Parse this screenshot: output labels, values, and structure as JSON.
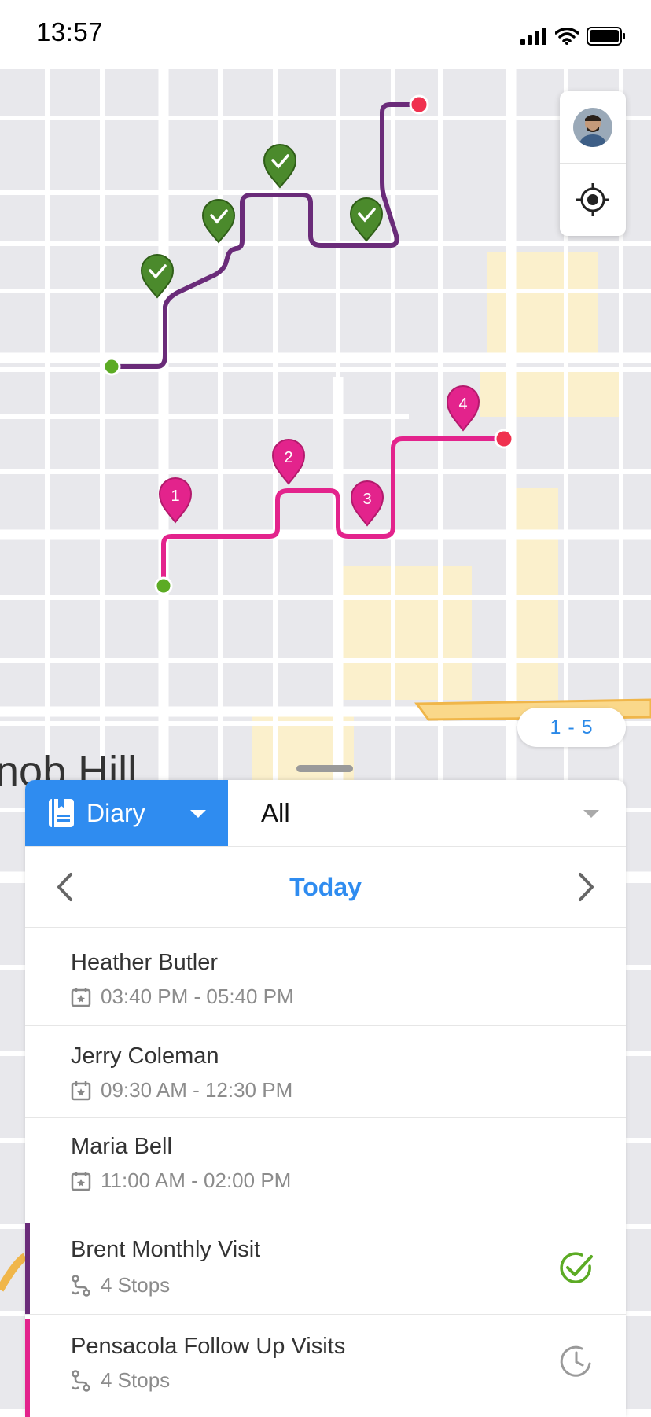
{
  "status_bar": {
    "time": "13:57"
  },
  "map": {
    "neighborhood_label": "nob Hill",
    "page_indicator": "1 - 5",
    "routes": [
      {
        "name": "Brent Monthly Visit",
        "color": "#6a2b79",
        "stops_completed": 4
      },
      {
        "name": "Pensacola Follow Up Visits",
        "color": "#e3238c",
        "stop_numbers": [
          "1",
          "2",
          "3",
          "4"
        ]
      }
    ],
    "start_marker_color": "#5cab24",
    "end_marker_color": "#f0314f"
  },
  "sheet": {
    "view_selector": {
      "label": "Diary",
      "icon": "diary-book-icon"
    },
    "filter": {
      "value": "All"
    },
    "date_nav": {
      "title": "Today"
    },
    "appointments": [
      {
        "name": "Heather Butler",
        "time": "03:40 PM - 05:40 PM"
      },
      {
        "name": "Jerry Coleman",
        "time": "09:30 AM - 12:30 PM"
      },
      {
        "name": "Maria Bell",
        "time": "11:00 AM - 02:00 PM"
      }
    ],
    "routes": [
      {
        "name": "Brent Monthly Visit",
        "stops": "4 Stops",
        "status": "completed-check-icon",
        "color": "#6a2b79"
      },
      {
        "name": "Pensacola Follow Up Visits",
        "stops": "4 Stops",
        "status": "pending-clock-icon",
        "color": "#e3238c"
      }
    ]
  },
  "colors": {
    "accent": "#2f8cf0",
    "completed": "#5cab24"
  }
}
